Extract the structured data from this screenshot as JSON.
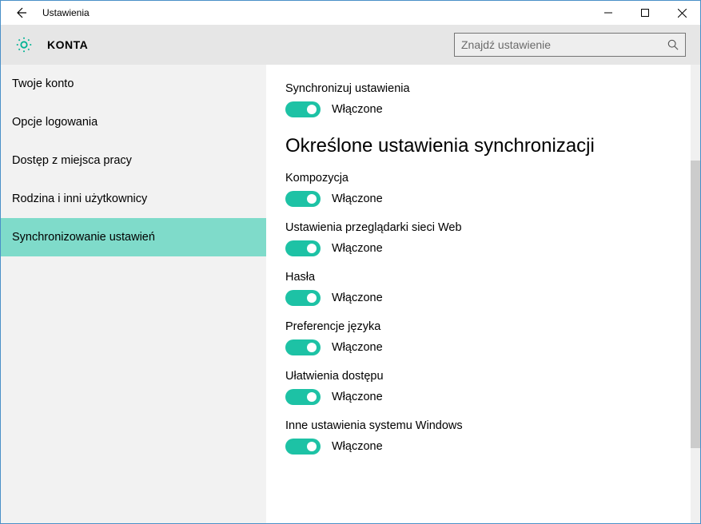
{
  "window": {
    "title": "Ustawienia"
  },
  "header": {
    "section_label": "KONTA",
    "search_placeholder": "Znajdź ustawienie"
  },
  "sidebar": {
    "items": [
      {
        "label": "Twoje konto",
        "selected": false
      },
      {
        "label": "Opcje logowania",
        "selected": false
      },
      {
        "label": "Dostęp z miejsca pracy",
        "selected": false
      },
      {
        "label": "Rodzina i inni użytkownicy",
        "selected": false
      },
      {
        "label": "Synchronizowanie ustawień",
        "selected": true
      }
    ]
  },
  "main": {
    "sync_master": {
      "label": "Synchronizuj ustawienia",
      "state": "Włączone"
    },
    "section_heading": "Określone ustawienia synchronizacji",
    "settings": [
      {
        "label": "Kompozycja",
        "state": "Włączone"
      },
      {
        "label": "Ustawienia przeglądarki sieci Web",
        "state": "Włączone"
      },
      {
        "label": "Hasła",
        "state": "Włączone"
      },
      {
        "label": "Preferencje języka",
        "state": "Włączone"
      },
      {
        "label": "Ułatwienia dostępu",
        "state": "Włączone"
      },
      {
        "label": "Inne ustawienia systemu Windows",
        "state": "Włączone"
      }
    ]
  }
}
